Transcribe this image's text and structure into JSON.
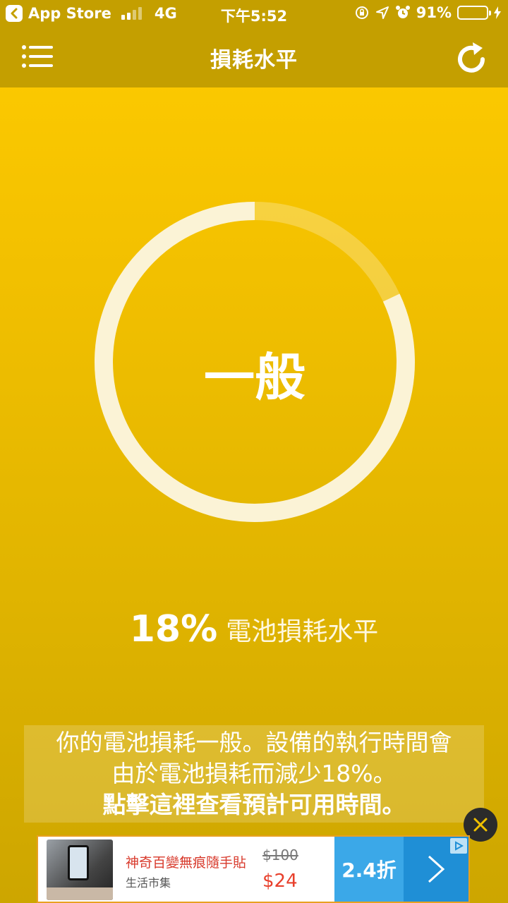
{
  "status_bar": {
    "back_app": "App Store",
    "network": "4G",
    "time": "下午5:52",
    "battery_percent_text": "91%",
    "battery_level": 0.91
  },
  "header": {
    "title": "損耗水平",
    "menu_icon": "list-menu-icon",
    "refresh_icon": "refresh-icon"
  },
  "gauge": {
    "status_label": "一般",
    "fill_fraction": 0.82
  },
  "stat": {
    "percent": "18%",
    "label": "電池損耗水平"
  },
  "message": {
    "line1": "你的電池損耗一般。設備的執行時間會",
    "line2": "由於電池損耗而減少18%。",
    "link": "點擊這裡查看預計可用時間。"
  },
  "ad": {
    "title": "神奇百變無痕隨手貼",
    "subtitle": "生活市集",
    "old_price": "$100",
    "new_price": "$24",
    "discount": "2.4折",
    "colors": {
      "discount_bg": "#3ba8e8",
      "arrow_bg": "#1f8fd6",
      "price": "#e8402c"
    }
  },
  "colors": {
    "bar": "#c49f00",
    "accent": "#ffcc00"
  }
}
